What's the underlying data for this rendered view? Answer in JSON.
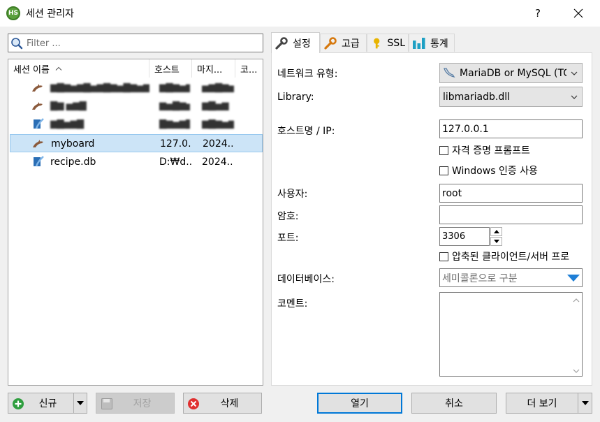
{
  "window": {
    "title": "세션 관리자",
    "help": "?",
    "app_icon_text": "HS"
  },
  "filter": {
    "placeholder": "Filter ..."
  },
  "list": {
    "columns": {
      "name": "세션 이름",
      "host": "호스트",
      "last": "마지...",
      "comment": "코..."
    },
    "rows": [
      {
        "name": "▆▇▆▅▆▇▅▆▇▆▅▇▆▅▆▇▆▅",
        "host": "▆▇▆▅▆",
        "last": "▅▆▇▆▅",
        "icon": "dolphin-icon",
        "blurred": true
      },
      {
        "name": "▇▆ ▅▆▇",
        "host": "▆▅▇▆▅",
        "last": "▆▇▅▆",
        "icon": "dolphin-icon",
        "blurred": true
      },
      {
        "name": "▆▇▅▆▇",
        "host": "▇▆▅▆▇",
        "last": "▆▇▆▅▆",
        "icon": "sqlite-icon",
        "blurred": true
      },
      {
        "name": "myboard",
        "host": "127.0...",
        "last": "2024...",
        "icon": "dolphin-icon",
        "blurred": false,
        "selected": true
      },
      {
        "name": "recipe.db",
        "host": "D:₩d...",
        "last": "2024...",
        "icon": "sqlite-icon",
        "blurred": false
      }
    ]
  },
  "bottom_left": {
    "new": "신규",
    "save": "저장",
    "delete": "삭제"
  },
  "tabs": [
    {
      "label": "설정",
      "icon": "wrench-icon"
    },
    {
      "label": "고급",
      "icon": "wrench-orange-icon"
    },
    {
      "label": "SSL",
      "icon": "key-icon"
    },
    {
      "label": "통계",
      "icon": "bar-chart-icon"
    }
  ],
  "settings": {
    "network_type_label": "네트워크 유형:",
    "network_type_value": "MariaDB or MySQL (TC",
    "library_label": "Library:",
    "library_value": "libmariadb.dll",
    "host_label": "호스트명 / IP:",
    "host_value": "127.0.0.1",
    "prompt_credentials": "자격 증명 프롬프트",
    "windows_auth": "Windows 인증 사용",
    "user_label": "사용자:",
    "user_value": "root",
    "password_label": "암호:",
    "password_value": "",
    "port_label": "포트:",
    "port_value": "3306",
    "compressed": "압축된 클라이언트/서버 프로",
    "database_label": "데이터베이스:",
    "database_placeholder": "세미콜론으로 구분",
    "comment_label": "코멘트:",
    "comment_value": ""
  },
  "bottom_right": {
    "open": "열기",
    "cancel": "취소",
    "more": "더 보기"
  },
  "colors": {
    "selection": "#cce4f7",
    "accent": "#0078d7",
    "new_icon": "#2e9e3e",
    "delete_icon": "#e03030"
  }
}
